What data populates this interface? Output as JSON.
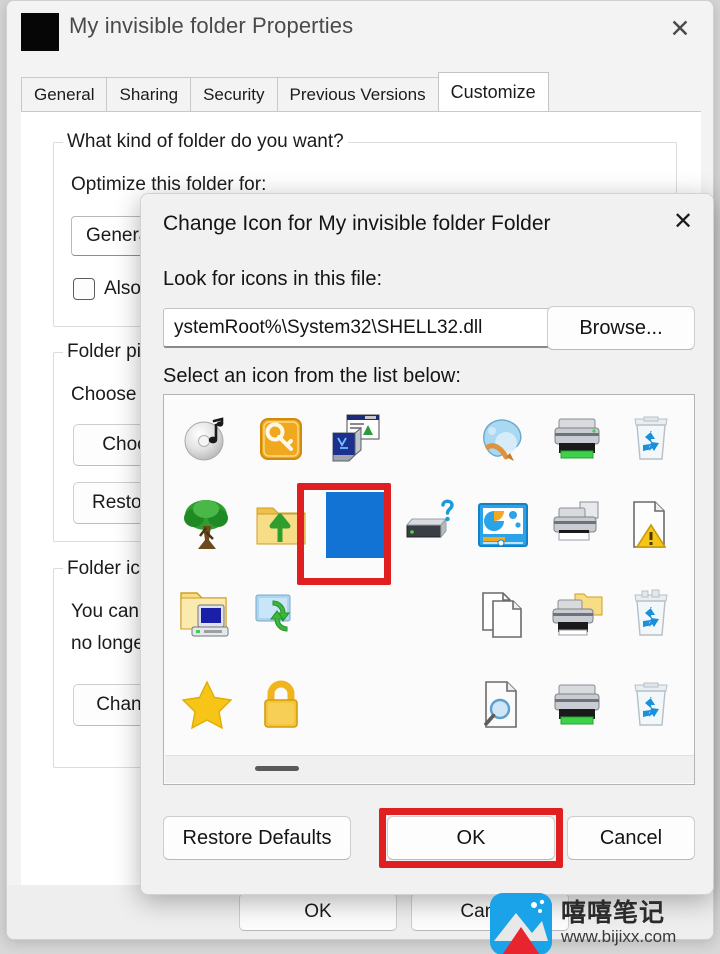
{
  "properties_window": {
    "title": "My invisible folder Properties",
    "app_icon": "black-square-icon",
    "close_label": "✕",
    "tabs": [
      {
        "label": "General",
        "active": false
      },
      {
        "label": "Sharing",
        "active": false
      },
      {
        "label": "Security",
        "active": false
      },
      {
        "label": "Previous Versions",
        "active": false
      },
      {
        "label": "Customize",
        "active": true
      }
    ],
    "customize": {
      "folder_type_group_label": "What kind of folder do you want?",
      "optimize_label": "Optimize this folder for:",
      "optimize_value": "General items",
      "also_checkbox_label": "Also apply this template to all subfolders",
      "folder_pictures_group_label": "Folder pictures",
      "choose_label": "Choose a file to show on this folder icon",
      "choose_file_button": "Choose File",
      "restore_default_button": "Restore Default",
      "folder_icons_group_label": "Folder icons",
      "folder_icons_text_line1": "You can change the folder icon. If you change the icon, it will",
      "folder_icons_text_line2": "no longer show a preview of the folder's contents.",
      "change_icon_button": "Change Icon..."
    },
    "footer": {
      "ok_label": "OK",
      "cancel_label": "Cancel"
    }
  },
  "change_icon_dialog": {
    "title": "Change Icon for My invisible folder Folder",
    "close_label": "✕",
    "file_label": "Look for icons in this file:",
    "file_value": "ystemRoot%\\System32\\SHELL32.dll",
    "browse_button": "Browse...",
    "list_label": "Select an icon from the list below:",
    "icons": [
      {
        "row": 0,
        "col": 0,
        "name": "audio-cd-icon"
      },
      {
        "row": 0,
        "col": 1,
        "name": "key-icon"
      },
      {
        "row": 0,
        "col": 2,
        "name": "computer-window-icon"
      },
      {
        "row": 0,
        "col": 4,
        "name": "paint-palette-icon"
      },
      {
        "row": 0,
        "col": 5,
        "name": "printer-icon"
      },
      {
        "row": 0,
        "col": 6,
        "name": "recycle-bin-empty-icon"
      },
      {
        "row": 0,
        "col": 7,
        "name": "blank-document-outline-icon"
      },
      {
        "row": 1,
        "col": 0,
        "name": "tree-icon"
      },
      {
        "row": 1,
        "col": 1,
        "name": "folder-upload-icon"
      },
      {
        "row": 1,
        "col": 2,
        "name": "blue-blank-icon",
        "selected": true
      },
      {
        "row": 1,
        "col": 3,
        "name": "unknown-device-icon"
      },
      {
        "row": 1,
        "col": 4,
        "name": "media-settings-icon"
      },
      {
        "row": 1,
        "col": 5,
        "name": "printer-add-icon"
      },
      {
        "row": 1,
        "col": 6,
        "name": "document-warning-icon"
      },
      {
        "row": 1,
        "col": 7,
        "name": "blank-document-outline-icon"
      },
      {
        "row": 2,
        "col": 0,
        "name": "network-folder-computer-icon"
      },
      {
        "row": 2,
        "col": 1,
        "name": "screen-sync-icon"
      },
      {
        "row": 2,
        "col": 4,
        "name": "copy-documents-icon"
      },
      {
        "row": 2,
        "col": 5,
        "name": "printer-folder-icon"
      },
      {
        "row": 2,
        "col": 6,
        "name": "recycle-bin-full-icon"
      },
      {
        "row": 2,
        "col": 7,
        "name": "folder-warning-icon"
      },
      {
        "row": 2,
        "col": 8,
        "name": "list-document-icon"
      },
      {
        "row": 3,
        "col": 0,
        "name": "star-icon"
      },
      {
        "row": 3,
        "col": 1,
        "name": "lock-icon"
      },
      {
        "row": 3,
        "col": 4,
        "name": "document-search-icon"
      },
      {
        "row": 3,
        "col": 5,
        "name": "printer-green-icon"
      },
      {
        "row": 3,
        "col": 6,
        "name": "recycle-bin-empty-icon"
      },
      {
        "row": 3,
        "col": 7,
        "name": "folder-edit-icon"
      },
      {
        "row": 3,
        "col": 8,
        "name": "blank-document-outline-icon"
      }
    ],
    "buttons": {
      "restore_defaults": "Restore Defaults",
      "ok": "OK",
      "cancel": "Cancel"
    },
    "highlight_color": "#e02020",
    "selected_icon_color": "#1273d4"
  },
  "watermark": {
    "brand_cn": "嘻嘻笔记",
    "url": "www.bijixx.com"
  }
}
